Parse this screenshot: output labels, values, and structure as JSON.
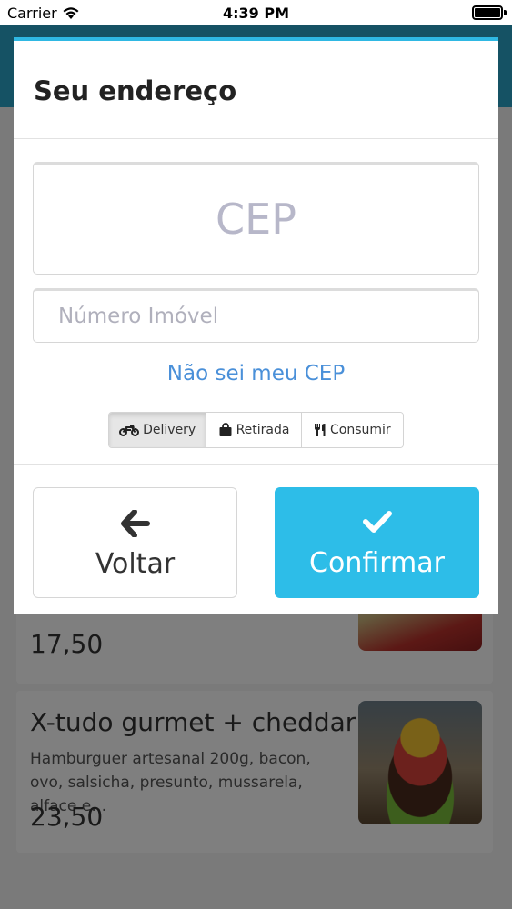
{
  "status_bar": {
    "carrier": "Carrier",
    "time": "4:39 PM"
  },
  "modal": {
    "title": "Seu endereço",
    "cep_placeholder": "CEP",
    "number_placeholder": "Número Imóvel",
    "unknown_cep_link": "Não sei meu CEP",
    "order_types": [
      {
        "label": "Delivery",
        "icon": "motorcycle-icon",
        "selected": true
      },
      {
        "label": "Retirada",
        "icon": "shopping-bag-icon",
        "selected": false
      },
      {
        "label": "Consumir",
        "icon": "cutlery-icon",
        "selected": false
      }
    ],
    "back_label": "Voltar",
    "confirm_label": "Confirmar"
  },
  "background": {
    "products": [
      {
        "price": "17,50"
      },
      {
        "title": "X-tudo gurmet + cheddar",
        "description": "Hamburguer artesanal 200g, bacon, ovo, salsicha, presunto, mussarela, alface e…",
        "price": "23,50"
      }
    ]
  },
  "colors": {
    "accent": "#2dbde8",
    "link": "#4a90d9",
    "header": "#2aa5c9"
  }
}
